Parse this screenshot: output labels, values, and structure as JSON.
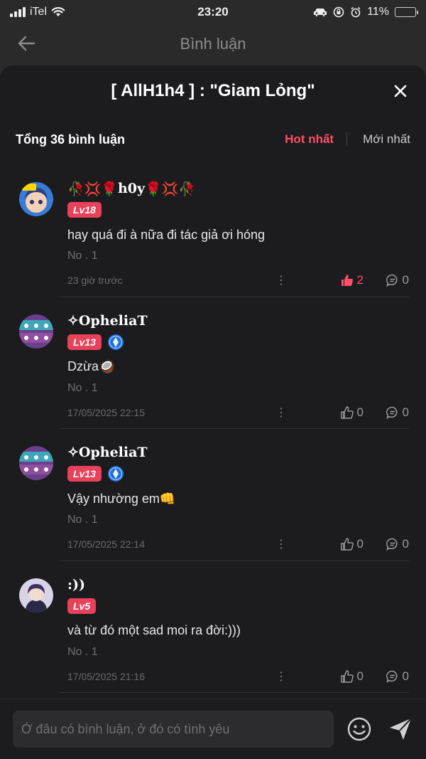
{
  "status": {
    "carrier": "iTel",
    "time": "23:20",
    "battery_text": "11%",
    "battery_fraction": 0.11
  },
  "header": {
    "title": "Bình luận"
  },
  "sheet": {
    "title": "[ AllH1h4 ] : \"Giam Lỏng\"",
    "total": "Tổng 36 bình luận",
    "sort_hot": "Hot nhất",
    "sort_new": "Mới nhất"
  },
  "comments": [
    {
      "name_deco_left": "🥀💢🌹",
      "name": "h0y",
      "name_deco_right": "🌹💢🥀",
      "level": "Lv18",
      "has_rank_icon": false,
      "text": "hay quá đi à nữa đi tác giả ơi hóng",
      "no": "No . 1",
      "time": "23 giờ trước",
      "likes": "2",
      "liked": true,
      "replies": "0"
    },
    {
      "name_deco_left": "",
      "name": "✧OpheliaT",
      "name_deco_right": "",
      "level": "Lv13",
      "has_rank_icon": true,
      "text": "Dzừa🥥",
      "no": "No . 1",
      "time": "17/05/2025 22:15",
      "likes": "0",
      "liked": false,
      "replies": "0"
    },
    {
      "name_deco_left": "",
      "name": "✧OpheliaT",
      "name_deco_right": "",
      "level": "Lv13",
      "has_rank_icon": true,
      "text": "Vậy nhường em👊",
      "no": "No . 1",
      "time": "17/05/2025 22:14",
      "likes": "0",
      "liked": false,
      "replies": "0"
    },
    {
      "name_deco_left": "",
      "name": ":))",
      "name_deco_right": "",
      "level": "Lv5",
      "has_rank_icon": false,
      "text": "và từ đó một sad moi ra đời:)))",
      "no": "No . 1",
      "time": "17/05/2025 21:16",
      "likes": "0",
      "liked": false,
      "replies": "0"
    }
  ],
  "composer": {
    "placeholder": "Ở đâu có bình luận, ở đó có tình yêu"
  },
  "colors": {
    "accent": "#ff4d6a",
    "level_badge": "#e8425b",
    "background": "#1c1c1e"
  }
}
